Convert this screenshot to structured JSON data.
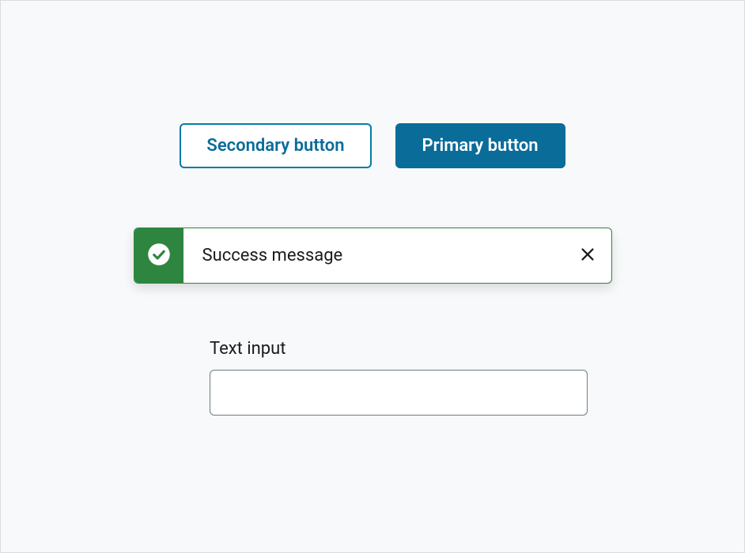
{
  "buttons": {
    "secondary_label": "Secondary button",
    "primary_label": "Primary button"
  },
  "alert": {
    "type": "success",
    "message": "Success message",
    "icon": "check-circle-icon",
    "color": "#2e8540"
  },
  "input": {
    "label": "Text input",
    "value": "",
    "placeholder": ""
  }
}
